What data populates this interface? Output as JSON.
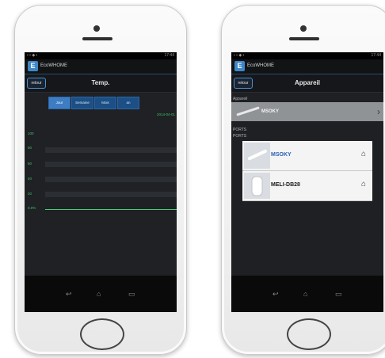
{
  "left_screen": {
    "app_title": "EcoWHOME",
    "back_label": "retour",
    "page_title": "Temp.",
    "segments": [
      "Jour",
      "Semaine",
      "Mois",
      "an"
    ],
    "active_segment": 0,
    "date_label": "2014-04-01",
    "y_labels": [
      "100",
      "80",
      "60",
      "40",
      "20",
      "0.0%"
    ],
    "status_left": "▪ ▪ ◆ ▪",
    "status_right": "17:44"
  },
  "right_screen": {
    "app_title": "EcoWHOME",
    "back_label": "retour",
    "page_title": "Appareil",
    "section_appareil": "Appareil",
    "selected_device": "MSOKY",
    "section_ports": "PORTS",
    "section_ports2": "PORTS",
    "devices": [
      {
        "name": "MSOKY",
        "highlight": true
      },
      {
        "name": "MELI-DB28",
        "highlight": false
      }
    ],
    "status_left": "▪ ▪ ◆ ▪",
    "status_right": "17:44"
  },
  "icons": {
    "back": "↩",
    "home": "⌂",
    "recents": "▭",
    "chevron": "›",
    "signal": "⌂"
  },
  "colors": {
    "accent": "#3d7dc4",
    "chart_green": "#3fd07a",
    "screen_bg": "#1f2124"
  }
}
